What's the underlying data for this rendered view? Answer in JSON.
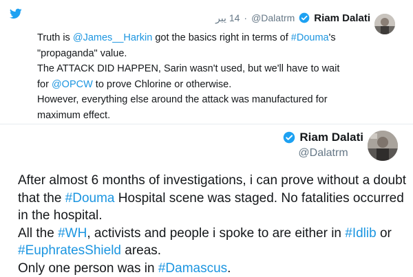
{
  "colors": {
    "link": "#1b95e0",
    "text": "#14171a",
    "muted": "#657786",
    "brand": "#1da1f2"
  },
  "icons": {
    "brand": "twitter-bird-icon",
    "verified": "verified-badge-icon"
  },
  "top_tweet": {
    "name": "Riam Dalati",
    "handle": "@Dalatrm",
    "separator": "·",
    "time": "14 يبر",
    "lines": [
      {
        "pre": "Truth is ",
        "link1": "@James__Harkin",
        "mid": " got the basics right in terms of ",
        "link2": "#Douma",
        "post": "'s"
      },
      {
        "text": "\"propaganda\" value."
      },
      {
        "text": "The ATTACK DID HAPPEN, Sarin wasn't used, but we'll have to wait"
      },
      {
        "pre": "for ",
        "link": "@OPCW",
        "post": " to prove Chlorine or otherwise."
      },
      {
        "text": "However, everything else around the attack was manufactured for"
      },
      {
        "text": "maximum effect."
      }
    ]
  },
  "main_tweet": {
    "name": "Riam Dalati",
    "handle": "@Dalatrm",
    "lines": [
      {
        "text": "After almost 6 months of investigations, i can prove without a doubt"
      },
      {
        "pre": "that the ",
        "link": "#Douma",
        "post": " Hospital scene was staged. No fatalities occurred"
      },
      {
        "text": "in the hospital."
      },
      {
        "pre": "All the ",
        "link1": "#WH",
        "mid": ", activists and people i spoke to are either in ",
        "link2": "#Idlib",
        "post": " or"
      },
      {
        "link": "#EuphratesShield",
        "post": " areas."
      },
      {
        "pre": "Only one person was in ",
        "link": "#Damascus",
        "post": "."
      }
    ]
  }
}
